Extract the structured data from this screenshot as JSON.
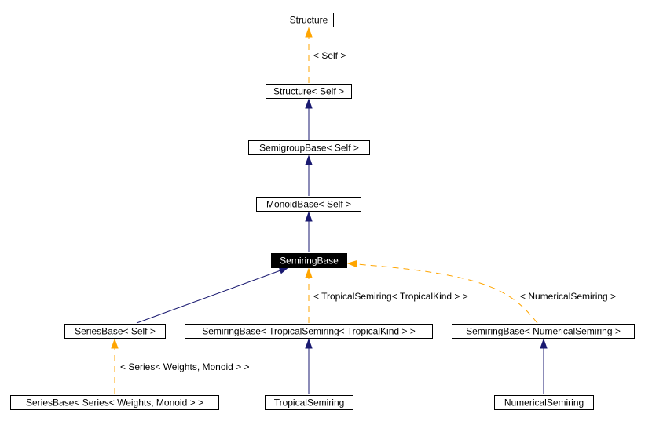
{
  "diagram": {
    "type": "class-inheritance-graph",
    "colors": {
      "inheritance": "#191970",
      "template": "#FFA500",
      "active_fill": "#000000",
      "active_text": "#FFFFFF"
    },
    "nodes": [
      {
        "id": "structure",
        "label": "Structure",
        "active": false
      },
      {
        "id": "structure-self",
        "label": "Structure< Self >",
        "active": false
      },
      {
        "id": "semigroupbase-self",
        "label": "SemigroupBase< Self >",
        "active": false
      },
      {
        "id": "monoidbase-self",
        "label": "MonoidBase< Self >",
        "active": false
      },
      {
        "id": "semiringbase",
        "label": "SemiringBase",
        "active": true
      },
      {
        "id": "seriesbase-self",
        "label": "SeriesBase< Self >",
        "active": false
      },
      {
        "id": "semiringbase-tropical",
        "label": "SemiringBase< TropicalSemiring< TropicalKind > >",
        "active": false
      },
      {
        "id": "semiringbase-numerical",
        "label": "SemiringBase< NumericalSemiring >",
        "active": false
      },
      {
        "id": "seriesbase-series",
        "label": "SeriesBase< Series< Weights, Monoid > >",
        "active": false
      },
      {
        "id": "tropicalsemiring",
        "label": "TropicalSemiring",
        "active": false
      },
      {
        "id": "numericalsemiring",
        "label": "NumericalSemiring",
        "active": false
      }
    ],
    "edges": [
      {
        "from": "structure-self",
        "to": "structure",
        "kind": "template",
        "label": "< Self >"
      },
      {
        "from": "semigroupbase-self",
        "to": "structure-self",
        "kind": "inheritance",
        "label": ""
      },
      {
        "from": "monoidbase-self",
        "to": "semigroupbase-self",
        "kind": "inheritance",
        "label": ""
      },
      {
        "from": "semiringbase",
        "to": "monoidbase-self",
        "kind": "inheritance",
        "label": ""
      },
      {
        "from": "seriesbase-self",
        "to": "semiringbase",
        "kind": "inheritance",
        "label": ""
      },
      {
        "from": "semiringbase-tropical",
        "to": "semiringbase",
        "kind": "template",
        "label": "< TropicalSemiring< TropicalKind > >"
      },
      {
        "from": "semiringbase-numerical",
        "to": "semiringbase",
        "kind": "template",
        "label": "< NumericalSemiring >"
      },
      {
        "from": "seriesbase-series",
        "to": "seriesbase-self",
        "kind": "template",
        "label": "< Series< Weights, Monoid > >"
      },
      {
        "from": "tropicalsemiring",
        "to": "semiringbase-tropical",
        "kind": "inheritance",
        "label": ""
      },
      {
        "from": "numericalsemiring",
        "to": "semiringbase-numerical",
        "kind": "inheritance",
        "label": ""
      }
    ]
  }
}
